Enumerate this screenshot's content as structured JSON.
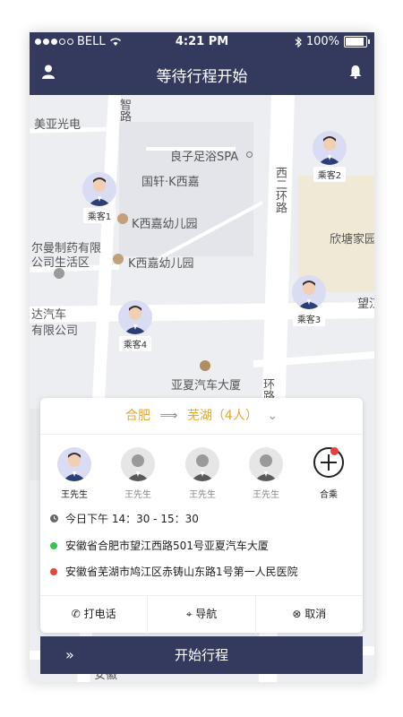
{
  "status_bar": {
    "carrier": "BELL",
    "time": "4:21 PM",
    "battery": "100%"
  },
  "header": {
    "title": "等待行程开始"
  },
  "map": {
    "labels": [
      "美亚光电",
      "良子足浴SPA",
      "国轩·K西嘉",
      "K西嘉幼儿园",
      "尔曼制药有限",
      "公司生活区",
      "K西嘉幼儿园",
      "西二环路",
      "欣塘家园",
      "望江",
      "亚夏汽车大厦",
      "达汽车",
      "有限公司",
      "智路",
      "环路",
      "安徽"
    ],
    "pins": [
      "乘客1",
      "乘客2",
      "乘客3",
      "乘客4"
    ]
  },
  "trip": {
    "from": "合肥",
    "to": "芜湖（4人）"
  },
  "passengers": [
    {
      "name": "王先生",
      "active": true
    },
    {
      "name": "王先生",
      "active": false
    },
    {
      "name": "王先生",
      "active": false
    },
    {
      "name": "王先生",
      "active": false
    }
  ],
  "add_label": "合乘",
  "time_text": "今日下午  14：30 - 15：30",
  "pickup_address": "安徽省合肥市望江西路501号亚夏汽车大厦",
  "dropoff_address": "安徽省芜湖市鸠江区赤铸山东路1号第一人民医院",
  "actions": {
    "call": "打电话",
    "navigate": "导航",
    "cancel": "取消"
  },
  "start_button": "开始行程",
  "colors": {
    "primary": "#333a5d",
    "route": "#e5a82a",
    "green": "#35c24d",
    "red": "#e4463f"
  }
}
